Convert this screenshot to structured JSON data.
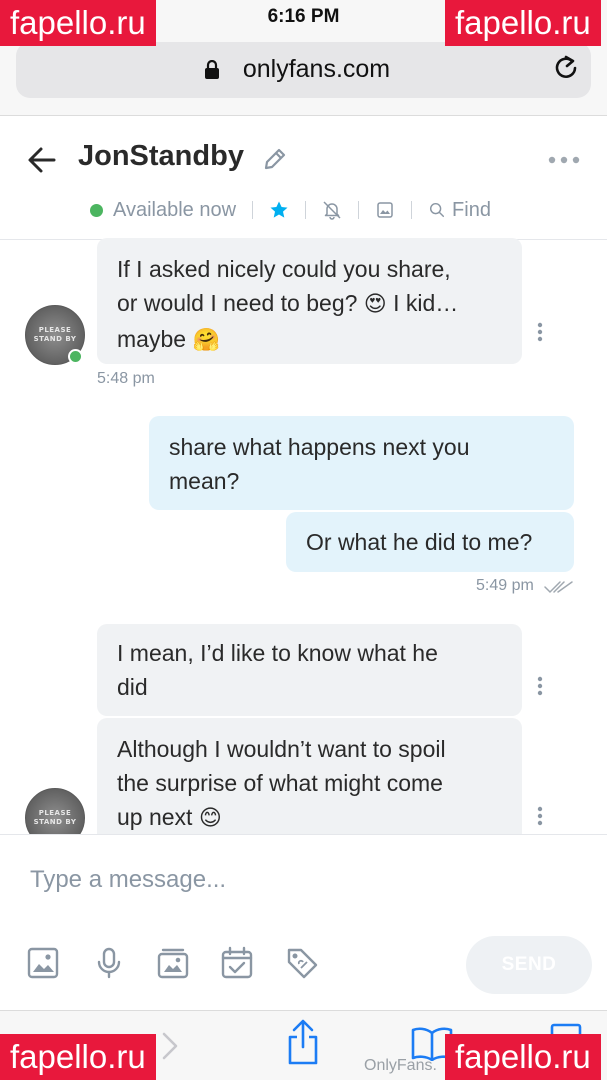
{
  "status_bar": {
    "time": "6:16 PM"
  },
  "browser": {
    "url": "onlyfans.com"
  },
  "header": {
    "username": "JonStandby",
    "status": "Available now",
    "find_label": "Find"
  },
  "avatar": {
    "text_line1": "PLEASE",
    "text_line2": "STAND BY"
  },
  "messages": [
    {
      "direction": "in",
      "lines": [
        "If I asked nicely could you share,",
        "or would I need to beg?",
        "I kid…",
        "maybe"
      ],
      "emojis": [
        "😍",
        "🤗"
      ],
      "time": "5:48 pm"
    },
    {
      "direction": "out",
      "lines": [
        "share what happens next you",
        "mean?"
      ]
    },
    {
      "direction": "out",
      "lines": [
        "Or what he did to me?"
      ],
      "time": "5:49 pm"
    },
    {
      "direction": "in",
      "lines": [
        "I mean, I’d like to know what he",
        "did"
      ]
    },
    {
      "direction": "in",
      "lines": [
        "Although I wouldn’t want to spoil",
        "the surprise of what might come",
        "up next"
      ],
      "emojis": [
        "😊"
      ]
    }
  ],
  "composer": {
    "placeholder": "Type a message...",
    "send_label": "SEND"
  },
  "safari": {
    "site_label": "OnlyFans."
  },
  "watermark": {
    "text": "fapello.ru"
  },
  "colors": {
    "accent": "#00aff0",
    "online": "#4cb560",
    "watermark": "#e8183c",
    "outgoing_bubble": "#e3f3fb",
    "incoming_bubble": "#f0f2f4"
  }
}
